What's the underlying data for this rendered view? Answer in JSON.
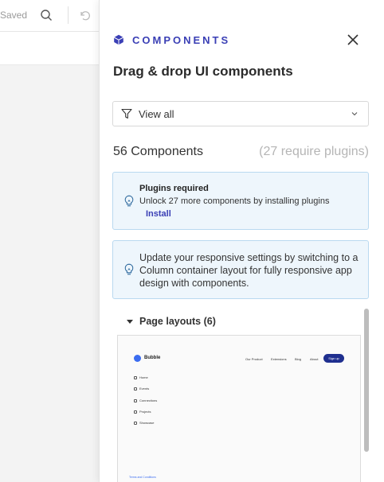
{
  "background": {
    "saved_label": "Saved",
    "search_icon": "search-icon",
    "undo_icon": "undo-icon"
  },
  "panel": {
    "title": "COMPONENTS",
    "subtitle": "Drag & drop UI components",
    "accent_color": "#3a3fb5",
    "filter": {
      "value": "View all"
    },
    "count_label": "56 Components",
    "require_label": "(27 require plugins)",
    "plugins_notice": {
      "title": "Plugins required",
      "body": "Unlock 27 more components by installing plugins",
      "link": "Install"
    },
    "responsive_notice": {
      "text": "Update your responsive settings by switching to a Column container layout for fully responsive app design with components."
    },
    "section": {
      "label": "Page layouts (6)"
    },
    "preview": {
      "brand": "Bubble",
      "nav": [
        "Our Product",
        "Extensions",
        "Blog",
        "About"
      ],
      "signup": "Sign up",
      "menu": [
        "Home",
        "Events",
        "Connections",
        "Projects",
        "Showcase"
      ],
      "terms": "Terms and Conditions"
    }
  }
}
